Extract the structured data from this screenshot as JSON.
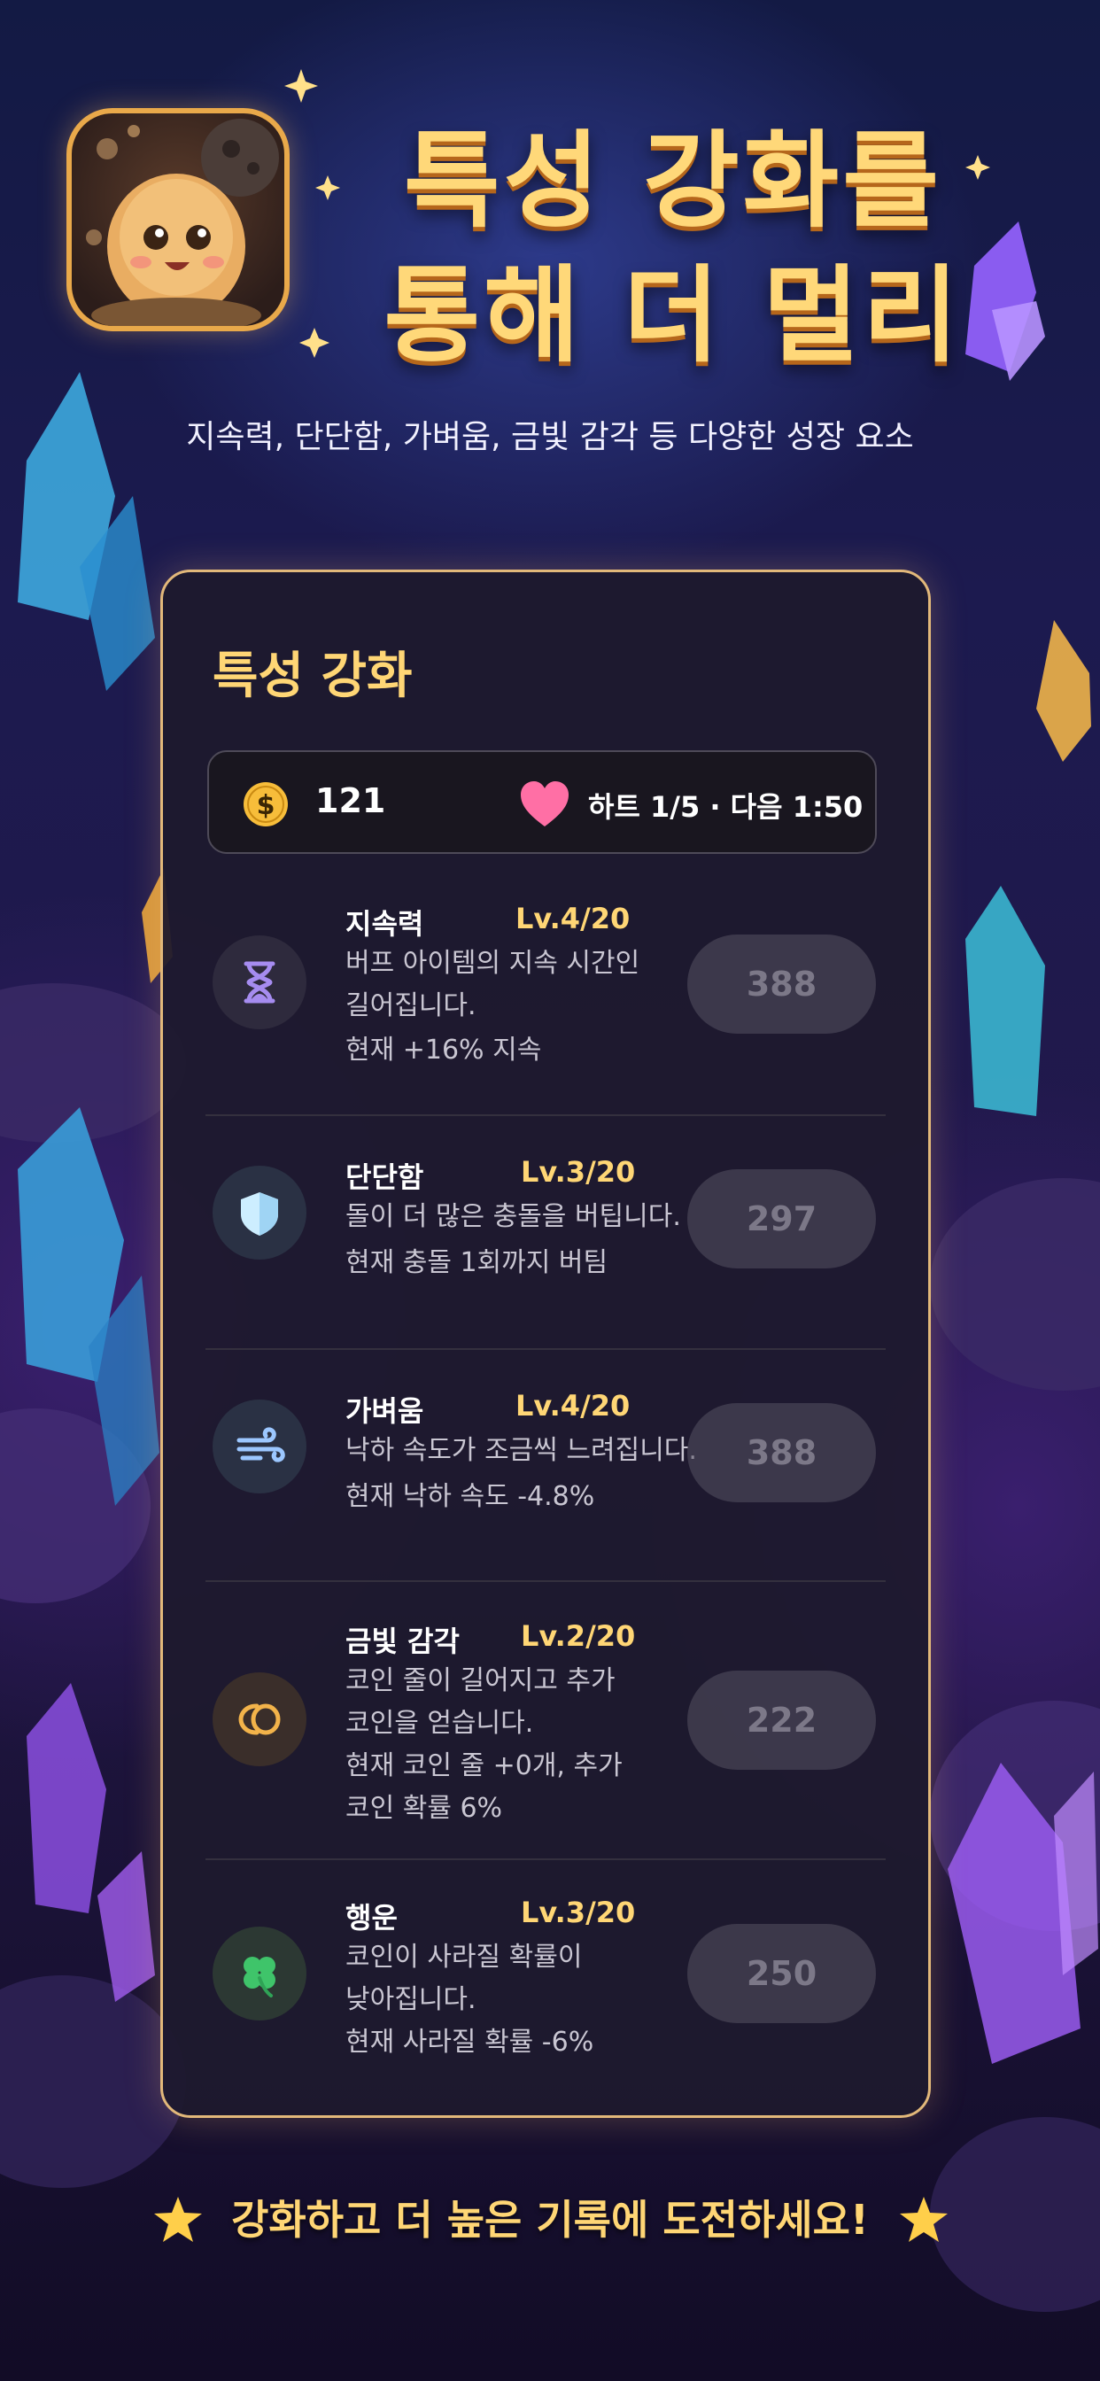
{
  "promo": {
    "headline_line1": "특성 강화를",
    "headline_line2": "통해 더 멀리",
    "subtitle": "지속력, 단단함, 가벼움, 금빛 감각 등 다양한 성장 요소",
    "footer": "강화하고 더 높은 기록에 도전하세요!",
    "app_icon": "potato-mascot-icon"
  },
  "panel": {
    "title": "특성 강화",
    "coins": "121",
    "hearts_text": "하트 1/5 · 다음 1:50",
    "coin_icon": "dollar-coin-icon",
    "heart_icon": "heart-icon"
  },
  "upgrades": [
    {
      "name": "지속력",
      "level": "Lv.4/20",
      "desc_lines": [
        "버프 아이템의 지속 시간인",
        "길어집니다."
      ],
      "current": "현재 +16% 지속",
      "cost": "388",
      "icon": "hourglass-icon",
      "icon_color": "#a68cf0"
    },
    {
      "name": "단단함",
      "level": "Lv.3/20",
      "desc_lines": [
        "돌이 더 많은 충돌을 버팁니다."
      ],
      "current": "현재 충돌 1회까지 버팀",
      "cost": "297",
      "icon": "shield-icon",
      "icon_color": "#bfe7ff"
    },
    {
      "name": "가벼움",
      "level": "Lv.4/20",
      "desc_lines": [
        "낙하 속도가 조금씩 느려집니다."
      ],
      "current": "현재 낙하 속도 -4.8%",
      "cost": "388",
      "icon": "wind-icon",
      "icon_color": "#9cc7ff"
    },
    {
      "name": "금빛 감각",
      "level": "Lv.2/20",
      "desc_lines": [
        "코인 줄이 길어지고 추가",
        "코인을 얻습니다."
      ],
      "current_lines": [
        "현재 코인 줄 +0개, 추가",
        "코인 확률 6%"
      ],
      "cost": "222",
      "icon": "coin-stack-icon",
      "icon_color": "#f2b34a"
    },
    {
      "name": "행운",
      "level": "Lv.3/20",
      "desc_lines": [
        "코인이 사라질 확률이",
        "낮아집니다."
      ],
      "current": "현재 사라질 확률 -6%",
      "cost": "250",
      "icon": "clover-icon",
      "icon_color": "#3fc46a"
    }
  ]
}
